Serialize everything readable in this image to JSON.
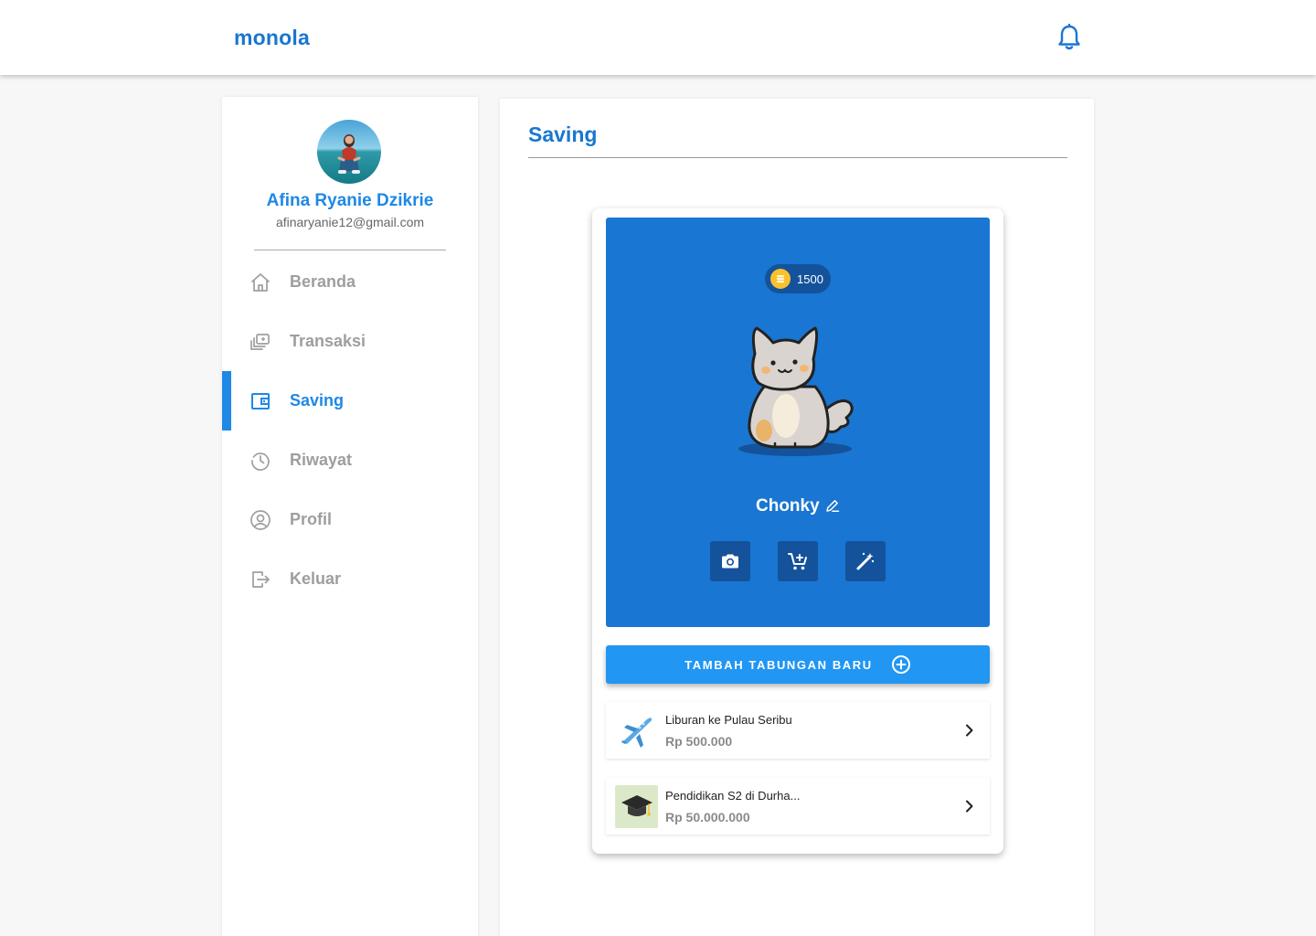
{
  "app": {
    "brand": "monola",
    "notification_icon": "bell-icon"
  },
  "user": {
    "name": "Afina Ryanie Dzikrie",
    "email": "afinaryanie12@gmail.com"
  },
  "sidebar": {
    "items": [
      {
        "label": "Beranda",
        "icon": "home-icon",
        "active": false
      },
      {
        "label": "Transaksi",
        "icon": "transaction-icon",
        "active": false
      },
      {
        "label": "Saving",
        "icon": "wallet-icon",
        "active": true
      },
      {
        "label": "Riwayat",
        "icon": "history-icon",
        "active": false
      },
      {
        "label": "Profil",
        "icon": "user-circle-icon",
        "active": false
      },
      {
        "label": "Keluar",
        "icon": "logout-icon",
        "active": false
      }
    ]
  },
  "main": {
    "title": "Saving",
    "pet": {
      "coins": "1500",
      "name": "Chonky"
    },
    "actions": [
      "camera-icon",
      "cart-add-icon",
      "magic-wand-icon"
    ],
    "add_button": "TAMBAH TABUNGAN BARU",
    "goals": [
      {
        "title": "Liburan ke Pulau Seribu",
        "amount": "Rp 500.000",
        "icon": "airplane-icon"
      },
      {
        "title": "Pendidikan S2 di Durha...",
        "amount": "Rp 50.000.000",
        "icon": "graduation-cap-icon"
      }
    ]
  },
  "colors": {
    "primary": "#1976d2",
    "accent": "#2196f3",
    "dark_accent": "#14529b",
    "coin": "#fbc02d"
  }
}
